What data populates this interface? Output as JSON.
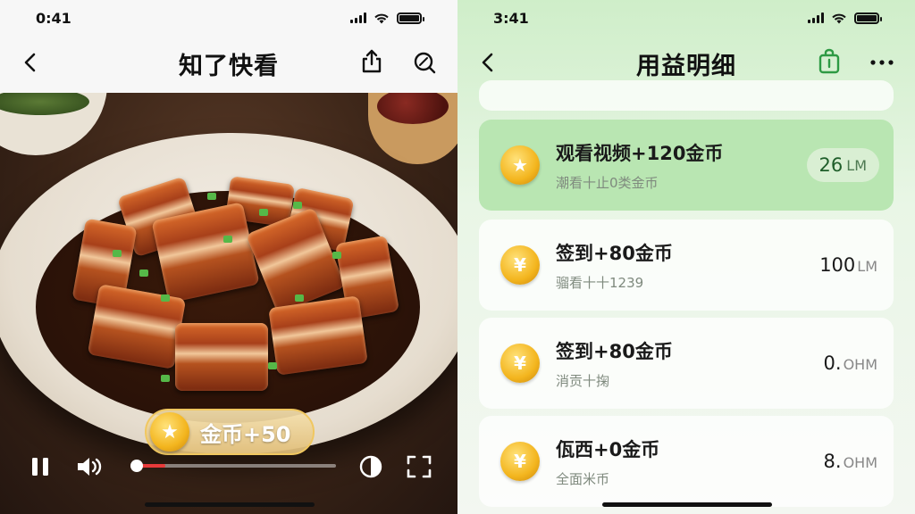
{
  "left": {
    "status": {
      "time": "0:41"
    },
    "nav": {
      "title": "知了快看"
    },
    "reward": {
      "label": "金币+50"
    }
  },
  "right": {
    "status": {
      "time": "3:41"
    },
    "nav": {
      "title": "用益明细"
    },
    "records": [
      {
        "title": "观看视频+120金币",
        "subtitle": "潮看十止0类金币",
        "amount": "26",
        "unit": "LM",
        "active": true,
        "icon": "star-coin-icon"
      },
      {
        "title": "签到+80金币",
        "subtitle": "骝看十十1239",
        "amount": "100",
        "unit": "LM",
        "active": false,
        "icon": "yen-coin-icon"
      },
      {
        "title": "签到+80金币",
        "subtitle": "消贡十掬",
        "amount": "0.",
        "unit": "OHM",
        "active": false,
        "icon": "yen-coin-icon"
      },
      {
        "title": "佤西+0金币",
        "subtitle": "全面米币",
        "amount": "8.",
        "unit": "OHM",
        "active": false,
        "icon": "yen-coin-icon"
      }
    ]
  },
  "colors": {
    "accent_green": "#2e9a44",
    "progress_red": "#e83a3a",
    "coin_gold": "#f3b51e"
  },
  "player": {
    "progress_fraction": 0.17
  }
}
